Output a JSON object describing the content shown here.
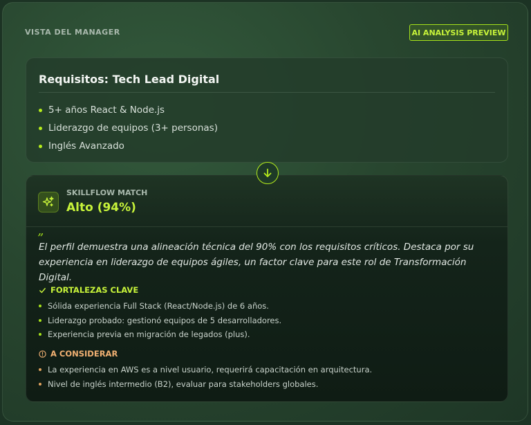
{
  "header": {
    "label": "VISTA DEL MANAGER",
    "badge": "AI ANALYSIS PREVIEW"
  },
  "requirements": {
    "title": "Requisitos: Tech Lead Digital",
    "items": [
      "5+ años React & Node.js",
      "Liderazgo de equipos (3+ personas)",
      "Inglés Avanzado"
    ]
  },
  "match": {
    "label": "SKILLFLOW MATCH",
    "value": "Alto (94%)",
    "quote_mark": "”",
    "summary": "El perfil demuestra una alineación técnica del 90% con los requisitos críticos. Destaca por su experiencia en liderazgo de equipos ágiles, un factor clave para este rol de Transformación Digital.",
    "strengths": {
      "title": "FORTALEZAS CLAVE",
      "items": [
        "Sólida experiencia Full Stack (React/Node.js) de 6 años.",
        "Liderazgo probado: gestionó equipos de 5 desarrolladores.",
        "Experiencia previa en migración de legados (plus)."
      ]
    },
    "considerations": {
      "title": "A CONSIDERAR",
      "items": [
        "La experiencia en AWS es a nivel usuario, requerirá capacitación en arquitectura.",
        "Nivel de inglés intermedio (B2), evaluar para stakeholders globales."
      ]
    }
  },
  "colors": {
    "accent": "#c7f33a",
    "warning": "#f0b072",
    "background": "#1c3324"
  },
  "icons": {
    "flow": "arrow-down-icon",
    "match": "sparkles-icon",
    "strengths": "check-icon",
    "considerations": "alert-circle-icon"
  }
}
